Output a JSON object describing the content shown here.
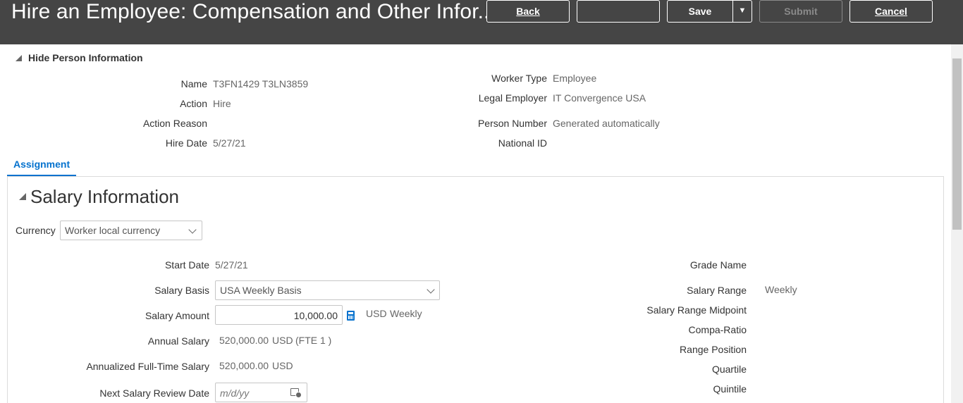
{
  "header": {
    "title": "Hire an Employee: Compensation and Other Infor...",
    "back_label": "Back",
    "blank_label": "",
    "save_label": "Save",
    "submit_label": "Submit",
    "cancel_label": "Cancel"
  },
  "person": {
    "toggle_label": "Hide Person Information",
    "name_label": "Name",
    "name_value": "T3FN1429 T3LN3859",
    "action_label": "Action",
    "action_value": "Hire",
    "action_reason_label": "Action Reason",
    "hire_date_label": "Hire Date",
    "hire_date_value": "5/27/21",
    "worker_type_label": "Worker Type",
    "worker_type_value": "Employee",
    "legal_employer_label": "Legal Employer",
    "legal_employer_value": "IT Convergence USA",
    "person_number_label": "Person Number",
    "person_number_value": "Generated automatically",
    "national_id_label": "National ID"
  },
  "tabs": [
    {
      "label": "Assignment",
      "selected": true
    }
  ],
  "salary": {
    "section_title": "Salary Information",
    "currency_label": "Currency",
    "currency_value": "Worker local currency",
    "start_date_label": "Start Date",
    "start_date_value": "5/27/21",
    "salary_basis_label": "Salary Basis",
    "salary_basis_value": "USA Weekly Basis",
    "salary_amount_label": "Salary Amount",
    "salary_amount_value": "10,000.00",
    "salary_amount_currency": "USD",
    "salary_amount_frequency": "Weekly",
    "annual_salary_label": "Annual Salary",
    "annual_salary_value": "520,000.00",
    "annual_salary_currency": "USD",
    "annual_salary_fte": "(FTE 1 )",
    "annualized_label": "Annualized Full-Time Salary",
    "annualized_value": "520,000.00",
    "annualized_currency": "USD",
    "next_review_label": "Next Salary Review Date",
    "next_review_placeholder": "m/d/yy",
    "grade_name_label": "Grade Name",
    "salary_range_label": "Salary Range",
    "salary_range_value": "Weekly",
    "midpoint_label": "Salary Range Midpoint",
    "compa_ratio_label": "Compa-Ratio",
    "range_position_label": "Range Position",
    "quartile_label": "Quartile",
    "quintile_label": "Quintile"
  },
  "colors": {
    "header_bg": "#454545",
    "accent": "#0572ce"
  }
}
